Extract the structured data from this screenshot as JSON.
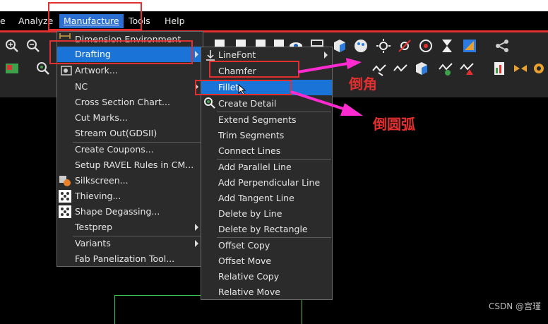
{
  "menubar": {
    "items": [
      "e",
      "Analyze",
      "Manufacture",
      "Tools",
      "Help"
    ]
  },
  "manufacture_menu": {
    "items": [
      "Dimension Environment",
      "Drafting",
      "Artwork...",
      "NC",
      "Cross Section Chart...",
      "Cut Marks...",
      "Stream Out(GDSII)",
      "Create Coupons...",
      "Setup RAVEL Rules in CM...",
      "Silkscreen...",
      "Thieving...",
      "Shape Degassing...",
      "Testprep",
      "Variants",
      "Fab Panelization Tool..."
    ]
  },
  "drafting_menu": {
    "items": [
      "LineFont",
      "Chamfer",
      "Fillet",
      "Create Detail",
      "Extend Segments",
      "Trim Segments",
      "Connect Lines",
      "Add Parallel Line",
      "Add Perpendicular Line",
      "Add Tangent Line",
      "Delete by Line",
      "Delete by Rectangle",
      "Offset Copy",
      "Offset Move",
      "Relative Copy",
      "Relative Move"
    ]
  },
  "annotations": {
    "chamfer": "倒角",
    "fillet": "倒圆弧"
  },
  "watermark": "CSDN @宫瑾",
  "colors": {
    "highlight": "#1a74d8",
    "annotation": "#e23030",
    "arrow": "#ff2bd0"
  },
  "icons": [
    "zoom-in-icon",
    "zoom-fit-icon",
    "layers-icon",
    "visibility-icon",
    "cube-icon",
    "palette-icon",
    "light-icon",
    "mirror-icon",
    "hourglass-icon",
    "measure-icon",
    "share-icon"
  ]
}
